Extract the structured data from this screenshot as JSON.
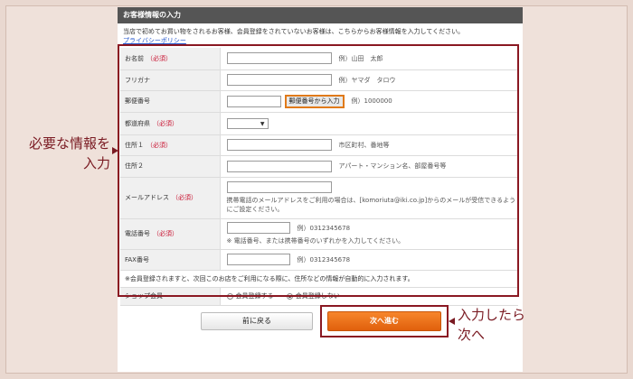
{
  "panel": {
    "title": "お客様情報の入力",
    "intro": "当店で初めてお買い物をされるお客様、会員登録をされていないお客様は、こちらからお客様情報を入力してください。",
    "privacy_link": "プライバシーポリシー"
  },
  "required_label": "（必須）",
  "fields": {
    "name": {
      "label": "お名前",
      "hint": "例）山田　太郎"
    },
    "furigana": {
      "label": "フリガナ",
      "hint": "例）ヤマダ　タロウ"
    },
    "postal": {
      "label": "郵便番号",
      "button": "郵便番号から入力",
      "hint": "例）1000000"
    },
    "prefecture": {
      "label": "都道府県"
    },
    "address1": {
      "label": "住所１",
      "hint": "市区町村、番地等"
    },
    "address2": {
      "label": "住所２",
      "hint": "アパート・マンション名、部屋番号等"
    },
    "email": {
      "label": "メールアドレス",
      "note": "携帯電話のメールアドレスをご利用の場合は、[komoriuta@iki.co.jp]からのメールが受信できるようにご設定ください。"
    },
    "phone": {
      "label": "電話番号",
      "hint": "例）0312345678",
      "sub_hint": "※ 電話番号、または携帯番号のいずれかを入力してください。"
    },
    "fax": {
      "label": "FAX番号",
      "hint": "例）0312345678"
    }
  },
  "member_notice": "※会員登録されますと、次回このお店をご利用になる際に、住所などの情報が自動的に入力されます。",
  "membership": {
    "label": "ショップ会員",
    "option_register": "会員登録する",
    "option_no_register": "会員登録しない",
    "selected": "会員登録しない"
  },
  "buttons": {
    "back": "前に戻る",
    "next": "次へ進む"
  },
  "annotations": {
    "left_line1": "必要な情報を",
    "left_line2": "入力",
    "right_line1": "入力したら",
    "right_line2": "次へ"
  },
  "colors": {
    "required": "#c8102e",
    "accent": "#e0600c",
    "annotation": "#7a1a22"
  }
}
